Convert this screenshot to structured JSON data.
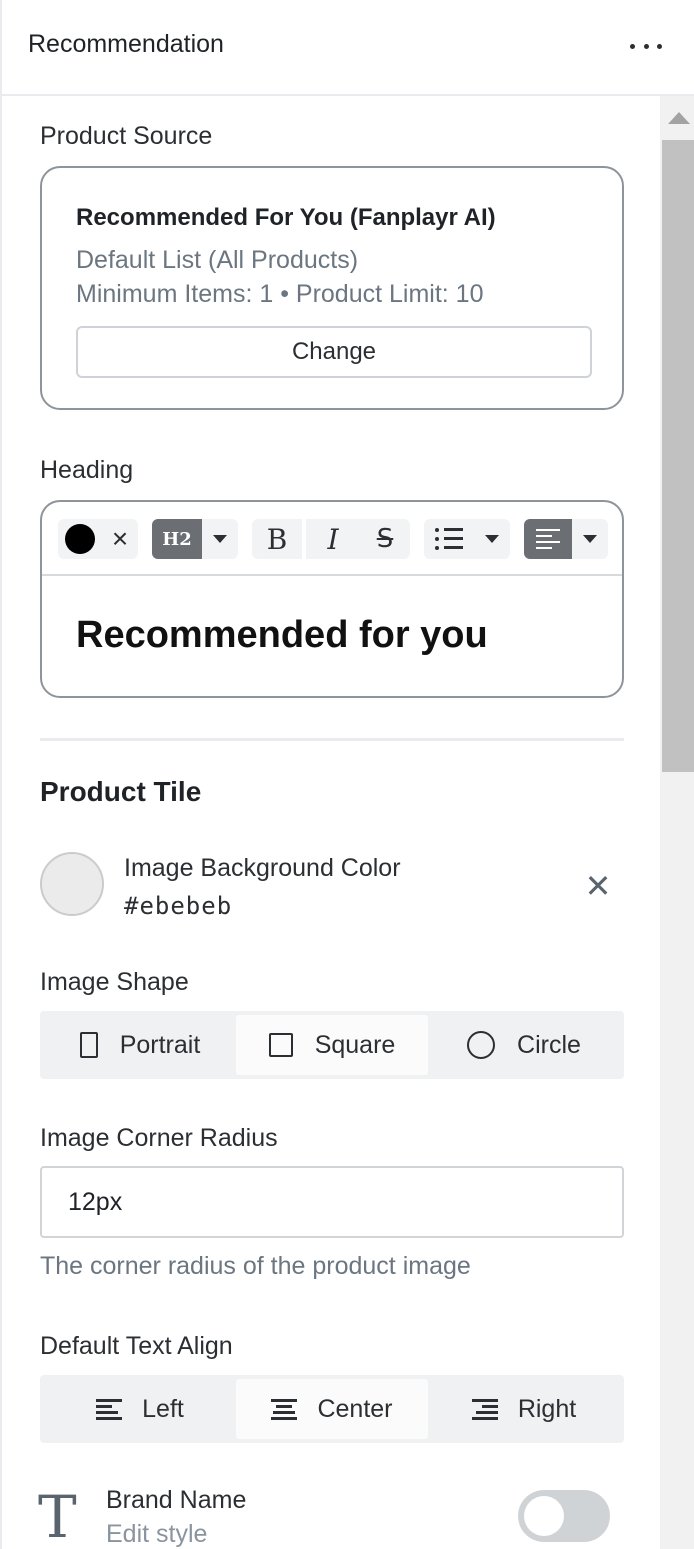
{
  "header": {
    "title": "Recommendation"
  },
  "product_source": {
    "label": "Product Source",
    "title": "Recommended For You (Fanplayr AI)",
    "list": "Default List (All Products)",
    "limits": "Minimum Items: 1 • Product Limit: 10",
    "change_label": "Change"
  },
  "heading": {
    "label": "Heading",
    "toolbar": {
      "heading_level": "H2",
      "bold": "B",
      "italic": "I",
      "strike": "S",
      "clear": "×"
    },
    "content": "Recommended for you"
  },
  "product_tile": {
    "title": "Product Tile",
    "image_bg": {
      "label": "Image Background Color",
      "value": "#ebebeb",
      "clear": "✕"
    },
    "image_shape": {
      "label": "Image Shape",
      "options": [
        "Portrait",
        "Square",
        "Circle"
      ],
      "selected": "Square"
    },
    "corner_radius": {
      "label": "Image Corner Radius",
      "value": "12px",
      "help": "The corner radius of the product image"
    },
    "text_align": {
      "label": "Default Text Align",
      "options": [
        "Left",
        "Center",
        "Right"
      ],
      "selected": "Center"
    },
    "brand_name": {
      "icon_glyph": "T",
      "label": "Brand Name",
      "edit": "Edit style",
      "enabled": false
    }
  },
  "colors": {
    "swatch": "#ebebeb",
    "accent_toolbar": "#6b6f73"
  }
}
